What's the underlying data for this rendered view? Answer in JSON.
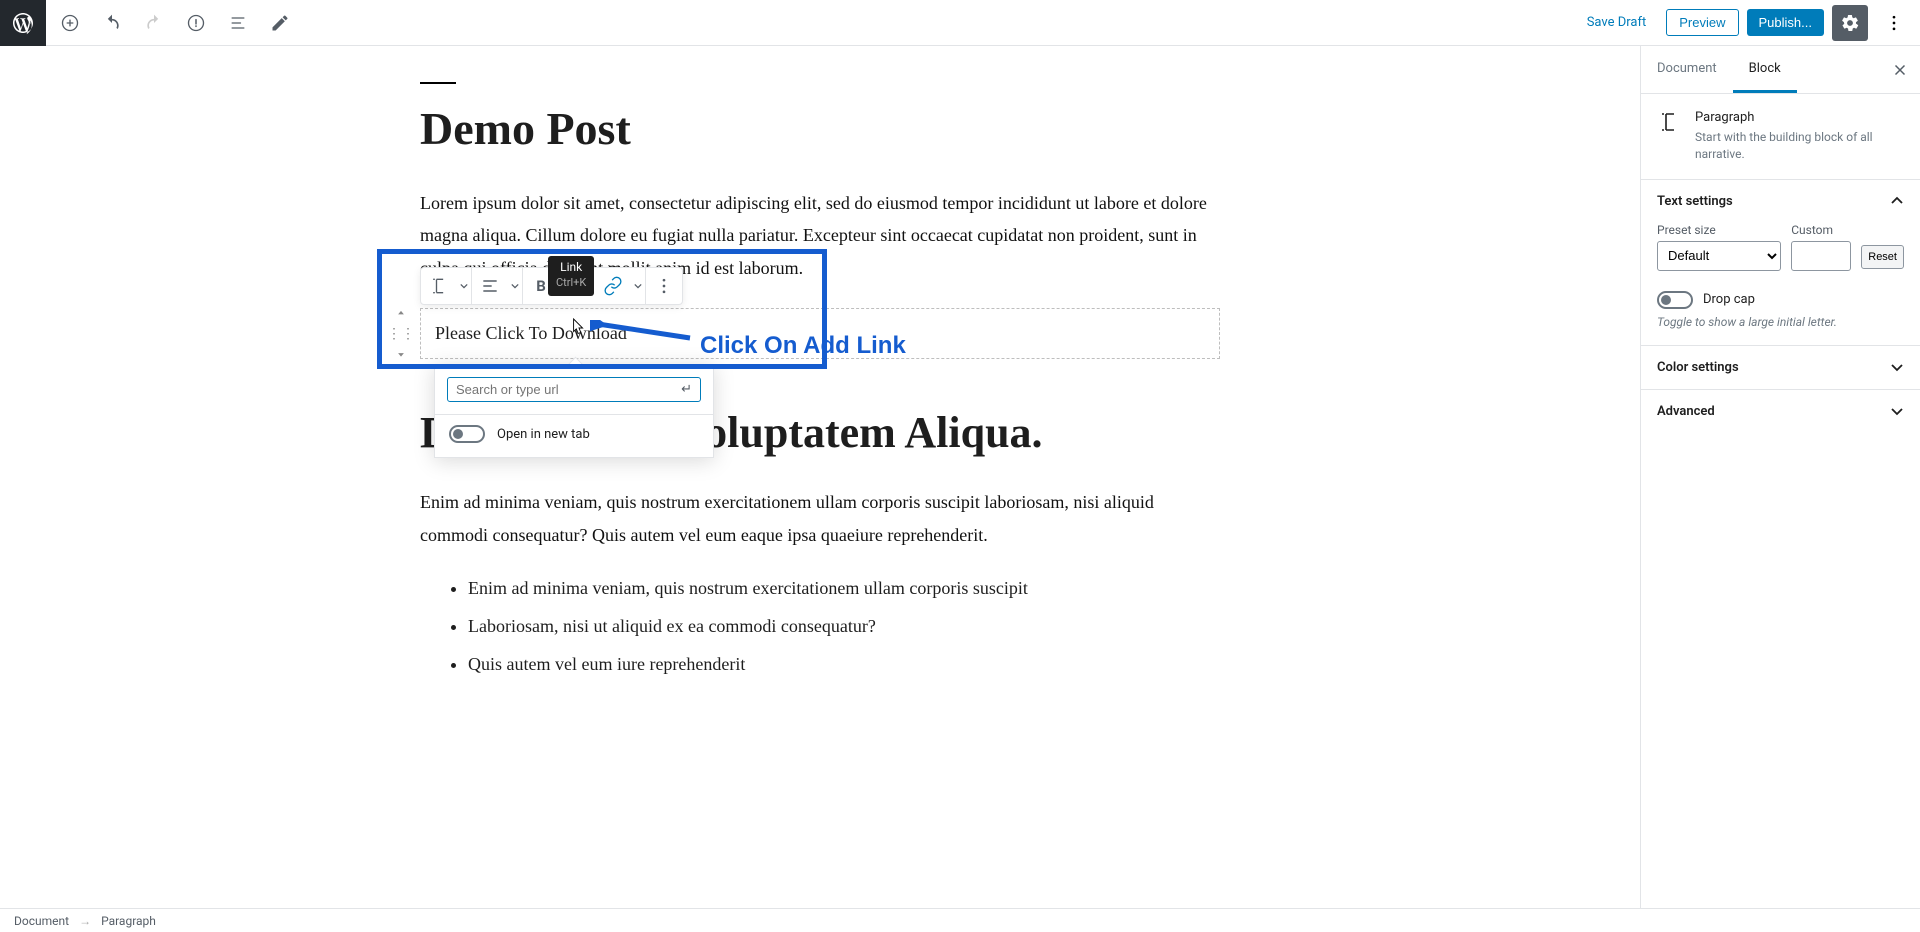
{
  "topbar": {
    "save_draft": "Save Draft",
    "preview": "Preview",
    "publish": "Publish..."
  },
  "post": {
    "title": "Demo Post",
    "para1": "Lorem ipsum dolor sit amet, consectetur adipiscing elit, sed do eiusmod tempor incididunt ut labore et dolore magna aliqua. Cillum dolore eu fugiat nulla pariatur. Excepteur sint occaecat cupidatat non proident, sunt in culpa qui officia deserunt mollit anim id est laborum.",
    "selected_text": "Please Click To Download",
    "h2": "Dolore Nemo Voluptatem Aliqua.",
    "para2": "Enim ad minima veniam, quis nostrum exercitationem ullam corporis suscipit laboriosam, nisi  aliquid  commodi consequatur? Quis autem vel eum eaque ipsa quaeiure reprehenderit.",
    "li1": "Enim ad minima veniam, quis nostrum exercitationem ullam corporis suscipit",
    "li2": "Laboriosam, nisi ut aliquid ex ea commodi consequatur?",
    "li3": "Quis autem vel eum iure reprehenderit"
  },
  "block_toolbar": {
    "tooltip_title": "Link",
    "tooltip_shortcut": "Ctrl+K"
  },
  "link_popover": {
    "url_placeholder": "Search or type url",
    "open_new_tab": "Open in new tab"
  },
  "annotation": {
    "label": "Click On Add Link"
  },
  "sidebar": {
    "tab_document": "Document",
    "tab_block": "Block",
    "block_name": "Paragraph",
    "block_desc": "Start with the building block of all narrative.",
    "text_settings": "Text settings",
    "preset_size": "Preset size",
    "preset_value": "Default",
    "custom": "Custom",
    "reset": "Reset",
    "drop_cap": "Drop cap",
    "drop_cap_hint": "Toggle to show a large initial letter.",
    "color_settings": "Color settings",
    "advanced": "Advanced"
  },
  "footer": {
    "crumb1": "Document",
    "crumb2": "Paragraph"
  }
}
